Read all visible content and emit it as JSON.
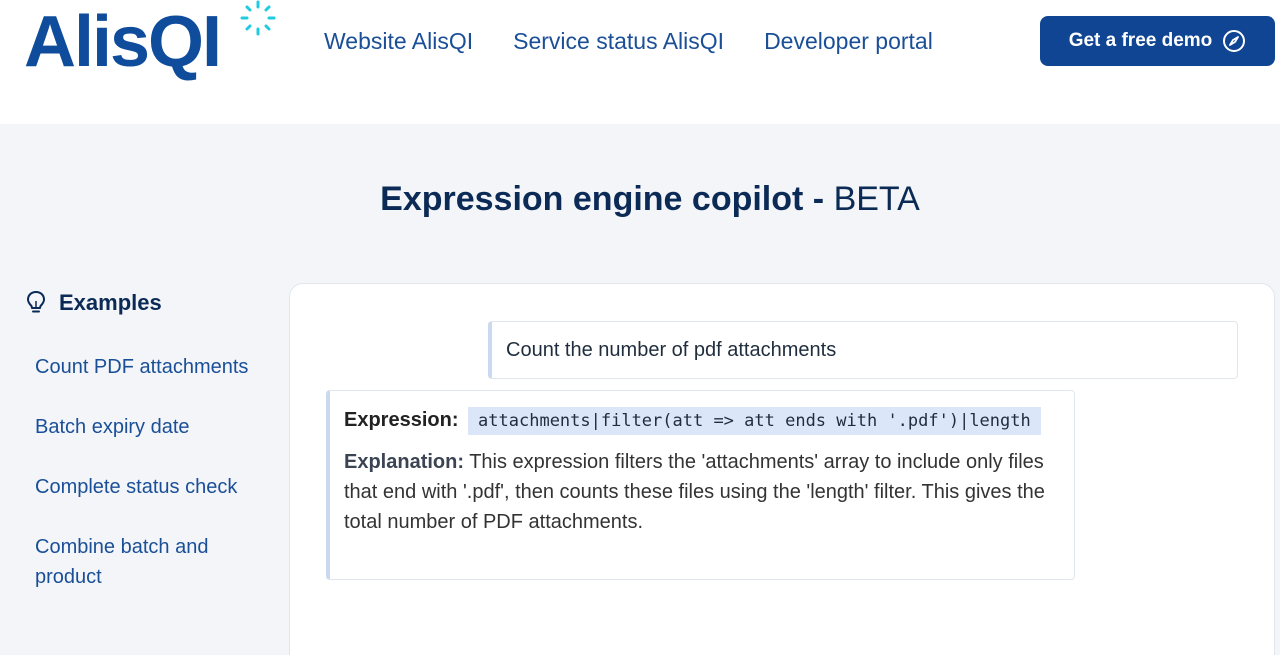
{
  "header": {
    "logo_text": "AlisQI",
    "nav": [
      {
        "label": "Website AlisQI"
      },
      {
        "label": "Service status AlisQI"
      },
      {
        "label": "Developer portal"
      }
    ],
    "cta_label": "Get a free demo"
  },
  "title": {
    "strong": "Expression engine copilot - ",
    "light": "BETA"
  },
  "sidebar": {
    "heading": "Examples",
    "items": [
      {
        "label": "Count PDF attachments"
      },
      {
        "label": "Batch expiry date"
      },
      {
        "label": "Complete status check"
      },
      {
        "label": "Combine batch and product"
      }
    ]
  },
  "chat": {
    "user_message": "Count the number of pdf attachments",
    "expression_label": "Expression:",
    "expression_code": "attachments|filter(att => att ends with '.pdf')|length",
    "explanation_label": "Explanation:",
    "explanation_text": " This expression filters the 'attachments' array to include only files that end with '.pdf', then counts these files using the 'length' filter. This gives the total number of PDF attachments."
  },
  "colors": {
    "brand": "#0f4c9c",
    "accent": "#1ecbe1",
    "button": "#0f4592"
  }
}
